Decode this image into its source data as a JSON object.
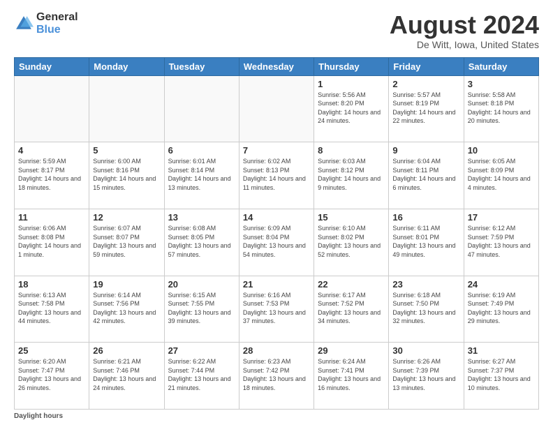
{
  "logo": {
    "general": "General",
    "blue": "Blue"
  },
  "title": "August 2024",
  "subtitle": "De Witt, Iowa, United States",
  "footer": {
    "label": "Daylight hours"
  },
  "weekdays": [
    "Sunday",
    "Monday",
    "Tuesday",
    "Wednesday",
    "Thursday",
    "Friday",
    "Saturday"
  ],
  "weeks": [
    [
      {
        "day": "",
        "sunrise": "",
        "sunset": "",
        "daylight": ""
      },
      {
        "day": "",
        "sunrise": "",
        "sunset": "",
        "daylight": ""
      },
      {
        "day": "",
        "sunrise": "",
        "sunset": "",
        "daylight": ""
      },
      {
        "day": "",
        "sunrise": "",
        "sunset": "",
        "daylight": ""
      },
      {
        "day": "1",
        "sunrise": "Sunrise: 5:56 AM",
        "sunset": "Sunset: 8:20 PM",
        "daylight": "Daylight: 14 hours and 24 minutes."
      },
      {
        "day": "2",
        "sunrise": "Sunrise: 5:57 AM",
        "sunset": "Sunset: 8:19 PM",
        "daylight": "Daylight: 14 hours and 22 minutes."
      },
      {
        "day": "3",
        "sunrise": "Sunrise: 5:58 AM",
        "sunset": "Sunset: 8:18 PM",
        "daylight": "Daylight: 14 hours and 20 minutes."
      }
    ],
    [
      {
        "day": "4",
        "sunrise": "Sunrise: 5:59 AM",
        "sunset": "Sunset: 8:17 PM",
        "daylight": "Daylight: 14 hours and 18 minutes."
      },
      {
        "day": "5",
        "sunrise": "Sunrise: 6:00 AM",
        "sunset": "Sunset: 8:16 PM",
        "daylight": "Daylight: 14 hours and 15 minutes."
      },
      {
        "day": "6",
        "sunrise": "Sunrise: 6:01 AM",
        "sunset": "Sunset: 8:14 PM",
        "daylight": "Daylight: 14 hours and 13 minutes."
      },
      {
        "day": "7",
        "sunrise": "Sunrise: 6:02 AM",
        "sunset": "Sunset: 8:13 PM",
        "daylight": "Daylight: 14 hours and 11 minutes."
      },
      {
        "day": "8",
        "sunrise": "Sunrise: 6:03 AM",
        "sunset": "Sunset: 8:12 PM",
        "daylight": "Daylight: 14 hours and 9 minutes."
      },
      {
        "day": "9",
        "sunrise": "Sunrise: 6:04 AM",
        "sunset": "Sunset: 8:11 PM",
        "daylight": "Daylight: 14 hours and 6 minutes."
      },
      {
        "day": "10",
        "sunrise": "Sunrise: 6:05 AM",
        "sunset": "Sunset: 8:09 PM",
        "daylight": "Daylight: 14 hours and 4 minutes."
      }
    ],
    [
      {
        "day": "11",
        "sunrise": "Sunrise: 6:06 AM",
        "sunset": "Sunset: 8:08 PM",
        "daylight": "Daylight: 14 hours and 1 minute."
      },
      {
        "day": "12",
        "sunrise": "Sunrise: 6:07 AM",
        "sunset": "Sunset: 8:07 PM",
        "daylight": "Daylight: 13 hours and 59 minutes."
      },
      {
        "day": "13",
        "sunrise": "Sunrise: 6:08 AM",
        "sunset": "Sunset: 8:05 PM",
        "daylight": "Daylight: 13 hours and 57 minutes."
      },
      {
        "day": "14",
        "sunrise": "Sunrise: 6:09 AM",
        "sunset": "Sunset: 8:04 PM",
        "daylight": "Daylight: 13 hours and 54 minutes."
      },
      {
        "day": "15",
        "sunrise": "Sunrise: 6:10 AM",
        "sunset": "Sunset: 8:02 PM",
        "daylight": "Daylight: 13 hours and 52 minutes."
      },
      {
        "day": "16",
        "sunrise": "Sunrise: 6:11 AM",
        "sunset": "Sunset: 8:01 PM",
        "daylight": "Daylight: 13 hours and 49 minutes."
      },
      {
        "day": "17",
        "sunrise": "Sunrise: 6:12 AM",
        "sunset": "Sunset: 7:59 PM",
        "daylight": "Daylight: 13 hours and 47 minutes."
      }
    ],
    [
      {
        "day": "18",
        "sunrise": "Sunrise: 6:13 AM",
        "sunset": "Sunset: 7:58 PM",
        "daylight": "Daylight: 13 hours and 44 minutes."
      },
      {
        "day": "19",
        "sunrise": "Sunrise: 6:14 AM",
        "sunset": "Sunset: 7:56 PM",
        "daylight": "Daylight: 13 hours and 42 minutes."
      },
      {
        "day": "20",
        "sunrise": "Sunrise: 6:15 AM",
        "sunset": "Sunset: 7:55 PM",
        "daylight": "Daylight: 13 hours and 39 minutes."
      },
      {
        "day": "21",
        "sunrise": "Sunrise: 6:16 AM",
        "sunset": "Sunset: 7:53 PM",
        "daylight": "Daylight: 13 hours and 37 minutes."
      },
      {
        "day": "22",
        "sunrise": "Sunrise: 6:17 AM",
        "sunset": "Sunset: 7:52 PM",
        "daylight": "Daylight: 13 hours and 34 minutes."
      },
      {
        "day": "23",
        "sunrise": "Sunrise: 6:18 AM",
        "sunset": "Sunset: 7:50 PM",
        "daylight": "Daylight: 13 hours and 32 minutes."
      },
      {
        "day": "24",
        "sunrise": "Sunrise: 6:19 AM",
        "sunset": "Sunset: 7:49 PM",
        "daylight": "Daylight: 13 hours and 29 minutes."
      }
    ],
    [
      {
        "day": "25",
        "sunrise": "Sunrise: 6:20 AM",
        "sunset": "Sunset: 7:47 PM",
        "daylight": "Daylight: 13 hours and 26 minutes."
      },
      {
        "day": "26",
        "sunrise": "Sunrise: 6:21 AM",
        "sunset": "Sunset: 7:46 PM",
        "daylight": "Daylight: 13 hours and 24 minutes."
      },
      {
        "day": "27",
        "sunrise": "Sunrise: 6:22 AM",
        "sunset": "Sunset: 7:44 PM",
        "daylight": "Daylight: 13 hours and 21 minutes."
      },
      {
        "day": "28",
        "sunrise": "Sunrise: 6:23 AM",
        "sunset": "Sunset: 7:42 PM",
        "daylight": "Daylight: 13 hours and 18 minutes."
      },
      {
        "day": "29",
        "sunrise": "Sunrise: 6:24 AM",
        "sunset": "Sunset: 7:41 PM",
        "daylight": "Daylight: 13 hours and 16 minutes."
      },
      {
        "day": "30",
        "sunrise": "Sunrise: 6:26 AM",
        "sunset": "Sunset: 7:39 PM",
        "daylight": "Daylight: 13 hours and 13 minutes."
      },
      {
        "day": "31",
        "sunrise": "Sunrise: 6:27 AM",
        "sunset": "Sunset: 7:37 PM",
        "daylight": "Daylight: 13 hours and 10 minutes."
      }
    ]
  ]
}
